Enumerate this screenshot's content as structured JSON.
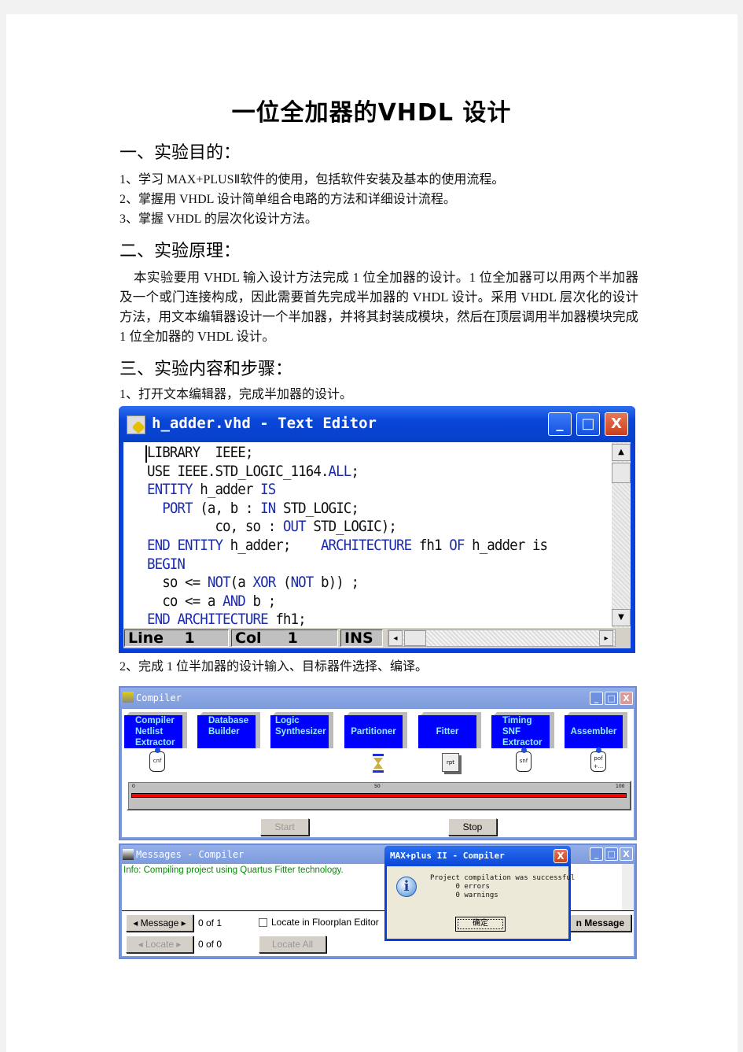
{
  "document": {
    "title": "一位全加器的VHDL 设计",
    "sections": [
      {
        "heading": "一、实验目的：",
        "items": [
          "1、学习 MAX+PLUSⅡ软件的使用，包括软件安装及基本的使用流程。",
          "2、掌握用 VHDL 设计简单组合电路的方法和详细设计流程。",
          "3、掌握 VHDL 的层次化设计方法。"
        ]
      },
      {
        "heading": "二、实验原理：",
        "paragraph": "本实验要用 VHDL 输入设计方法完成 1 位全加器的设计。1 位全加器可以用两个半加器及一个或门连接构成，因此需要首先完成半加器的 VHDL 设计。采用 VHDL 层次化的设计方法，用文本编辑器设计一个半加器，并将其封装成模块，然后在顶层调用半加器模块完成 1 位全加器的 VHDL 设计。"
      },
      {
        "heading": "三、实验内容和步骤：",
        "steps": [
          "1、打开文本编辑器，完成半加器的设计。",
          "2、完成 1 位半加器的设计输入、目标器件选择、编译。"
        ]
      }
    ]
  },
  "text_editor": {
    "title": "h_adder.vhd - Text Editor",
    "window_buttons": {
      "minimize": "_",
      "maximize": "□",
      "close": "X"
    },
    "code_lines": [
      "LIBRARY  IEEE;",
      "USE IEEE.STD_LOGIC_1164.ALL;",
      "ENTITY h_adder IS",
      "  PORT (a, b : IN STD_LOGIC;",
      "         co, so : OUT STD_LOGIC);",
      "END ENTITY h_adder;    ARCHITECTURE fh1 OF h_adder is",
      "BEGIN",
      "  so <= NOT(a XOR (NOT b)) ;",
      "  co <= a AND b ;",
      "END ARCHITECTURE fh1;"
    ],
    "status": {
      "line_label": "Line",
      "line_value": "1",
      "col_label": "Col",
      "col_value": "1",
      "mode": "INS"
    },
    "scroll_up": "▲",
    "scroll_down": "▼",
    "scroll_left": "◂",
    "scroll_right": "▸"
  },
  "compiler": {
    "title": "Compiler",
    "modules": [
      {
        "label": "Compiler Netlist Extractor",
        "output": "cnf"
      },
      {
        "label": "Database Builder",
        "output": ""
      },
      {
        "label": "Logic Synthesizer",
        "output": ""
      },
      {
        "label": "Partitioner",
        "output": "hourglass"
      },
      {
        "label": "Fitter",
        "output": "rpt"
      },
      {
        "label": "Timing SNF Extractor",
        "output": "snf"
      },
      {
        "label": "Assembler",
        "output": "pof +..."
      }
    ],
    "progress": {
      "value_percent": 100,
      "ticks": [
        "0",
        "50",
        "100"
      ],
      "bar_color": "#ff0000"
    },
    "start_button": "Start",
    "stop_button": "Stop"
  },
  "messages": {
    "title": "Messages - Compiler",
    "text": "Info: Compiling project using Quartus Fitter technology.",
    "message_button": "◂ Message ▸",
    "message_count": "0 of 1",
    "locate_button": "◂  Locate  ▸",
    "locate_count": "0 of 0",
    "locate_floorplan_label": "Locate in Floorplan Editor",
    "locate_floorplan_checked": false,
    "locate_all_button": "Locate All",
    "help_button_partial": "n Message"
  },
  "dialog": {
    "title": "MAX+plus II - Compiler",
    "message_lines": "Project compilation was successful\n      0 errors\n      0 warnings",
    "ok_button": "确定",
    "close": "X"
  }
}
